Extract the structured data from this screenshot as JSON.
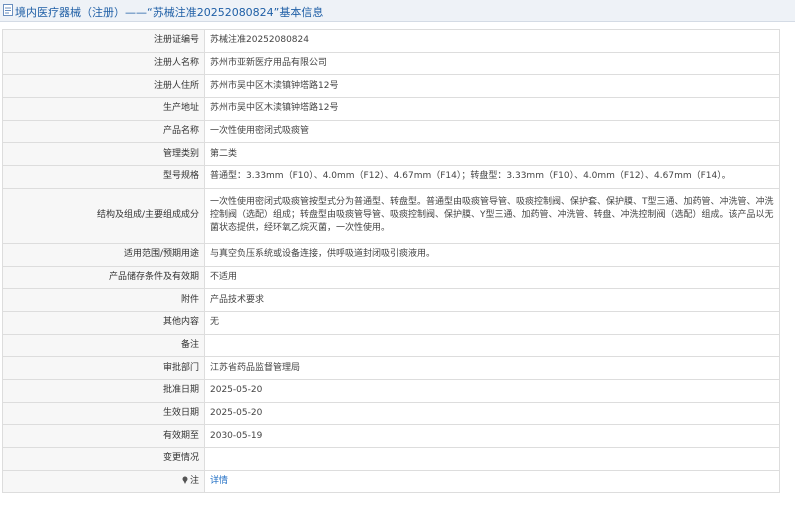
{
  "header": {
    "title": "境内医疗器械（注册）——“苏械注准20252080824”基本信息"
  },
  "rows": [
    {
      "label": "注册证编号",
      "value": "苏械注准20252080824"
    },
    {
      "label": "注册人名称",
      "value": "苏州市亚新医疗用品有限公司"
    },
    {
      "label": "注册人住所",
      "value": "苏州市吴中区木渎镇钟塔路12号"
    },
    {
      "label": "生产地址",
      "value": "苏州市吴中区木渎镇钟塔路12号"
    },
    {
      "label": "产品名称",
      "value": "一次性使用密闭式吸痰管"
    },
    {
      "label": "管理类别",
      "value": "第二类"
    },
    {
      "label": "型号规格",
      "value": "普通型：3.33mm（F10）、4.0mm（F12）、4.67mm（F14）；转盘型：3.33mm（F10）、4.0mm（F12）、4.67mm（F14）。"
    },
    {
      "label": "结构及组成/主要组成成分",
      "value": "一次性使用密闭式吸痰管按型式分为普通型、转盘型。普通型由吸痰管导管、吸痰控制阀、保护套、保护膜、T型三通、加药管、冲洗管、冲洗控制阀（选配）组成；转盘型由吸痰管导管、吸痰控制阀、保护膜、Y型三通、加药管、冲洗管、转盘、冲洗控制阀（选配）组成。该产品以无菌状态提供，经环氧乙烷灭菌，一次性使用。"
    },
    {
      "label": "适用范围/预期用途",
      "value": "与真空负压系统或设备连接，供呼吸道封闭吸引痰液用。"
    },
    {
      "label": "产品储存条件及有效期",
      "value": "不适用"
    },
    {
      "label": "附件",
      "value": "产品技术要求"
    },
    {
      "label": "其他内容",
      "value": "无"
    },
    {
      "label": "备注",
      "value": ""
    },
    {
      "label": "审批部门",
      "value": "江苏省药品监督管理局"
    },
    {
      "label": "批准日期",
      "value": "2025-05-20"
    },
    {
      "label": "生效日期",
      "value": "2025-05-20"
    },
    {
      "label": "有效期至",
      "value": "2030-05-19"
    },
    {
      "label": "变更情况",
      "value": ""
    },
    {
      "label": "注",
      "value": "详情"
    }
  ],
  "colors": {
    "title": "#1f5fa6",
    "link": "#1f6ec4",
    "label_bg": "#f7f7f7",
    "border": "#dddddd"
  },
  "icons": {
    "title_icon": "document-icon",
    "note_icon": "pin-icon"
  }
}
